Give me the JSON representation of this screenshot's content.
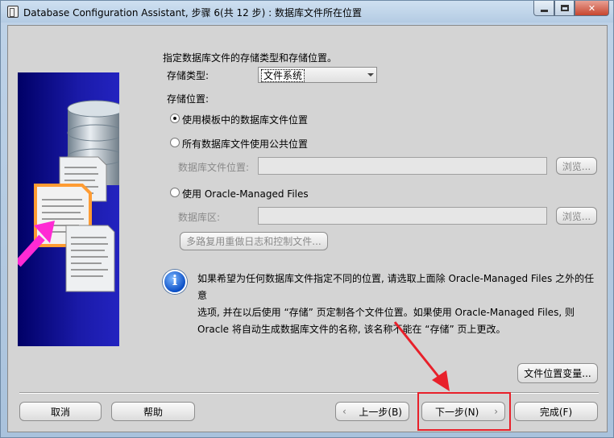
{
  "window": {
    "title": "Database Configuration Assistant, 步骤 6(共 12 步) : 数据库文件所在位置",
    "close_glyph": "✕"
  },
  "intro": "指定数据库文件的存储类型和存储位置。",
  "storage_type": {
    "label": "存储类型:",
    "value": "文件系统"
  },
  "storage_location": {
    "label": "存储位置:",
    "option_template": "使用模板中的数据库文件位置",
    "option_common": "所有数据库文件使用公共位置",
    "db_file_location_label": "数据库文件位置:",
    "db_file_location_value": "",
    "browse_label_1": "浏览...",
    "option_omf": "使用 Oracle-Managed Files",
    "db_area_label": "数据库区:",
    "db_area_value": "",
    "browse_label_2": "浏览...",
    "multiplex_label": "多路复用重做日志和控制文件..."
  },
  "info": {
    "icon_glyph": "i",
    "line1": "如果希望为任何数据库文件指定不同的位置, 请选取上面除 Oracle-Managed Files 之外的任意",
    "line2": "选项, 并在以后使用 “存储” 页定制各个文件位置。如果使用 Oracle-Managed Files, 则",
    "line3": "Oracle 将自动生成数据库文件的名称, 该名称不能在 “存储” 页上更改。"
  },
  "file_location_vars_label": "文件位置变量...",
  "footer": {
    "cancel": "取消",
    "help": "帮助",
    "back": "上一步(B)",
    "next": "下一步(N)",
    "finish": "完成(F)"
  },
  "colors": {
    "highlight": "#e8202a",
    "graphic_bg": "#1a1aa8"
  }
}
